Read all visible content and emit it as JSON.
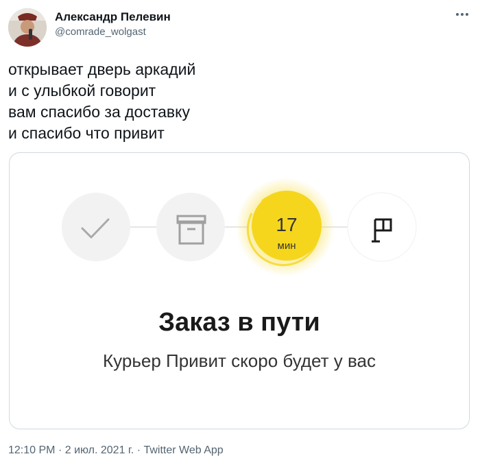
{
  "author": {
    "name": "Александр Пелевин",
    "handle": "@comrade_wolgast"
  },
  "tweet": {
    "lines": [
      "открывает дверь аркадий",
      "и с улыбкой говорит",
      "вам спасибо за доставку",
      "и спасибо что привит"
    ]
  },
  "media": {
    "progress_steps": [
      {
        "icon": "check-icon",
        "state": "done"
      },
      {
        "icon": "package-icon",
        "state": "done"
      },
      {
        "icon": "eta-timer",
        "state": "active"
      },
      {
        "icon": "flag-icon",
        "state": "pending"
      }
    ],
    "eta": {
      "number": "17",
      "unit": "мин"
    },
    "title": "Заказ в пути",
    "subtitle": "Курьер Привит скоро будет у вас",
    "accent_color": "#f5d61d"
  },
  "footer": {
    "time": "12:10 PM",
    "sep1": "·",
    "date": "2 июл. 2021 г.",
    "sep2": "·",
    "source": "Twitter Web App"
  }
}
